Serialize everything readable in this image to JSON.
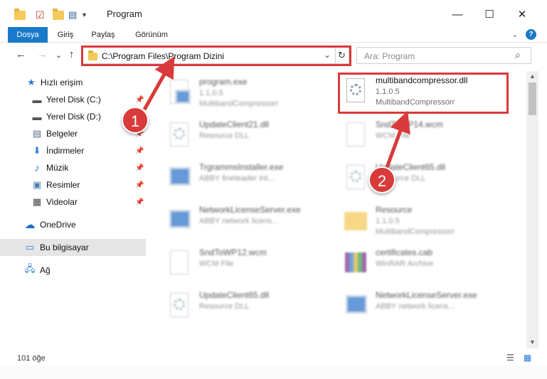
{
  "window": {
    "title": "Program",
    "minimize_glyph": "—",
    "maximize_glyph": "☐",
    "close_glyph": "✕"
  },
  "ribbon": {
    "tabs": [
      "Dosya",
      "Giriş",
      "Paylaş",
      "Görünüm"
    ],
    "collapse_glyph": "⌄",
    "help_glyph": "?"
  },
  "nav": {
    "back_glyph": "←",
    "forward_glyph": "→",
    "recent_glyph": "⌄",
    "up_glyph": "↑",
    "address": "C:\\Program Files\\Program Dizini",
    "dropdown_glyph": "⌄",
    "refresh_glyph": "↻",
    "search_placeholder": "Ara: Program",
    "search_glyph": "⌕"
  },
  "sidebar": {
    "pin_glyph": "📌",
    "items": [
      {
        "label": "Hızlı erişim",
        "icon": "star-icon",
        "glyph": "★"
      },
      {
        "label": "Yerel Disk (C:)",
        "icon": "drive-icon",
        "glyph": "▬"
      },
      {
        "label": "Yerel Disk (D:)",
        "icon": "drive-icon",
        "glyph": "▬"
      },
      {
        "label": "Belgeler",
        "icon": "documents-icon",
        "glyph": "▤"
      },
      {
        "label": "İndirmeler",
        "icon": "download-icon",
        "glyph": "⬇"
      },
      {
        "label": "Müzik",
        "icon": "music-icon",
        "glyph": "♪"
      },
      {
        "label": "Resimler",
        "icon": "pictures-icon",
        "glyph": "▣"
      },
      {
        "label": "Videolar",
        "icon": "video-icon",
        "glyph": "▦"
      },
      {
        "label": "OneDrive",
        "icon": "cloud-icon",
        "glyph": "☁"
      },
      {
        "label": "Bu bilgisayar",
        "icon": "computer-icon",
        "glyph": "▭"
      },
      {
        "label": "Ağ",
        "icon": "network-icon",
        "glyph": "🖧"
      }
    ]
  },
  "files": [
    {
      "name": "program.exe",
      "line1": "1.1.0.5",
      "line2": "MultibandCompressorr",
      "icon": "installer-icon"
    },
    {
      "name": "multibandcompressor.dll",
      "line1": "1.1.0.5",
      "line2": "MultibandCompressorr",
      "icon": "dll-gear-icon"
    },
    {
      "name": "UpdateClient21.dll",
      "line1": "Resource DLL",
      "line2": "",
      "icon": "dll-gear-icon"
    },
    {
      "name": "SndToWP14.wcm",
      "line1": "WCM File",
      "line2": "",
      "icon": "document-icon"
    },
    {
      "name": "TrgrammsInstaller.exe",
      "line1": "ABBY fineteader Int...",
      "line2": "",
      "icon": "app-window-icon"
    },
    {
      "name": "UpdateClient65.dll",
      "line1": "Resource DLL",
      "line2": "",
      "icon": "dll-gear-icon"
    },
    {
      "name": "NetworkLicenseServer.exe",
      "line1": "ABBY network licens...",
      "line2": "",
      "icon": "app-window-icon"
    },
    {
      "name": "Resource",
      "line1": "1.1.0.5",
      "line2": "MultibandCompressorr",
      "icon": "folder-icon"
    },
    {
      "name": "SndToWP12.wcm",
      "line1": "WCM File",
      "line2": "",
      "icon": "document-icon"
    },
    {
      "name": "certificates.cab",
      "line1": "WinRAR Archive",
      "line2": "",
      "icon": "archive-icon"
    },
    {
      "name": "UpdateClient65.dll",
      "line1": "Resource DLL",
      "line2": "",
      "icon": "dll-gear-icon"
    },
    {
      "name": "NetworkLicenseServer.exe",
      "line1": "ABBY network licens...",
      "line2": "",
      "icon": "app-window-icon"
    }
  ],
  "annotations": [
    {
      "number": "1"
    },
    {
      "number": "2"
    }
  ],
  "status": {
    "count": "101 öğe",
    "details_view_glyph": "☰",
    "icons_view_glyph": "▦"
  },
  "colors": {
    "accent": "#1979ca",
    "annotation": "#d93a3a"
  }
}
